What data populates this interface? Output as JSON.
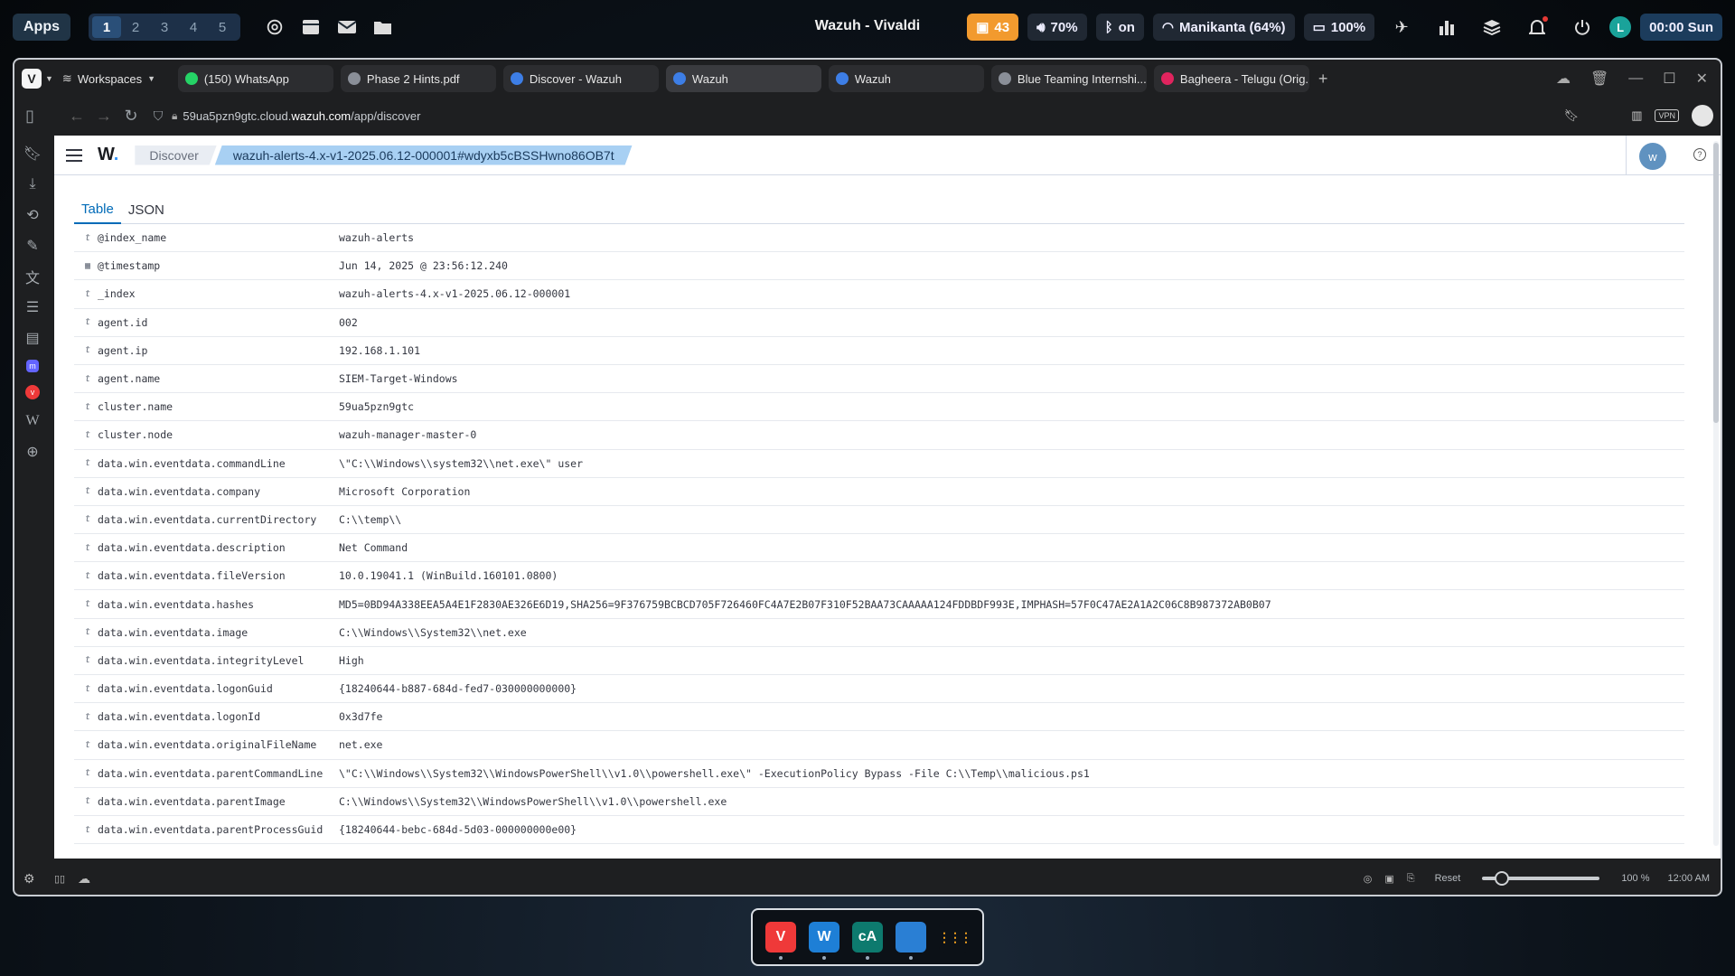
{
  "desktop": {
    "apps_label": "Apps",
    "workspaces": [
      "1",
      "2",
      "3",
      "4",
      "5"
    ],
    "active_workspace": "1",
    "window_title": "Wazuh - Vivaldi",
    "tray": {
      "updates": "43",
      "volume": "70%",
      "bluetooth": "on",
      "wifi": "Manikanta (64%)",
      "battery": "100%",
      "user_initial": "L",
      "clock": "00:00 Sun"
    }
  },
  "browser": {
    "workspaces_label": "Workspaces",
    "tabs": [
      {
        "label": "(150) WhatsApp",
        "icon": "whatsapp-icon",
        "color": "#25d366"
      },
      {
        "label": "Phase 2 Hints.pdf",
        "icon": "pdf-icon",
        "color": "#8a8f98"
      },
      {
        "label": "Discover - Wazuh",
        "icon": "wazuh-icon",
        "color": "#3d7ee6"
      },
      {
        "label": "Wazuh",
        "icon": "wazuh-icon",
        "color": "#3d7ee6"
      },
      {
        "label": "Wazuh",
        "icon": "wazuh-icon",
        "color": "#3d7ee6"
      },
      {
        "label": "Blue Teaming Internshi...",
        "icon": "link-icon",
        "color": "#8a8f98"
      },
      {
        "label": "Bagheera - Telugu (Orig...",
        "icon": "music-icon",
        "color": "#e0245e"
      }
    ],
    "active_tab": 3,
    "url_prefix": "59ua5pzn9gtc.cloud.",
    "url_domain": "wazuh.com",
    "url_path": "/app/discover",
    "status": {
      "reset_label": "Reset",
      "zoom": "100 %",
      "time": "12:00 AM",
      "zoom_fraction": 0.17
    }
  },
  "wazuh": {
    "logo": "W",
    "crumb_discover": "Discover",
    "crumb_doc": "wazuh-alerts-4.x-v1-2025.06.12-000001#wdyxb5cBSSHwno86OB7t",
    "avatar": "w",
    "tabs": [
      "Table",
      "JSON"
    ],
    "active_tab": "Table",
    "fields": [
      {
        "type": "t",
        "name": "@index_name",
        "value": "wazuh-alerts"
      },
      {
        "type": "date",
        "name": "@timestamp",
        "value": "Jun 14, 2025 @ 23:56:12.240"
      },
      {
        "type": "t",
        "name": "_index",
        "value": "wazuh-alerts-4.x-v1-2025.06.12-000001"
      },
      {
        "type": "t",
        "name": "agent.id",
        "value": "002"
      },
      {
        "type": "t",
        "name": "agent.ip",
        "value": "192.168.1.101"
      },
      {
        "type": "t",
        "name": "agent.name",
        "value": "SIEM-Target-Windows"
      },
      {
        "type": "t",
        "name": "cluster.name",
        "value": "59ua5pzn9gtc"
      },
      {
        "type": "t",
        "name": "cluster.node",
        "value": "wazuh-manager-master-0"
      },
      {
        "type": "t",
        "name": "data.win.eventdata.commandLine",
        "value": "\\\"C:\\\\Windows\\\\system32\\\\net.exe\\\" user"
      },
      {
        "type": "t",
        "name": "data.win.eventdata.company",
        "value": "Microsoft Corporation"
      },
      {
        "type": "t",
        "name": "data.win.eventdata.currentDirectory",
        "value": "C:\\\\temp\\\\"
      },
      {
        "type": "t",
        "name": "data.win.eventdata.description",
        "value": "Net Command"
      },
      {
        "type": "t",
        "name": "data.win.eventdata.fileVersion",
        "value": "10.0.19041.1 (WinBuild.160101.0800)"
      },
      {
        "type": "t",
        "name": "data.win.eventdata.hashes",
        "value": "MD5=0BD94A338EEA5A4E1F2830AE326E6D19,SHA256=9F376759BCBCD705F726460FC4A7E2B07F310F52BAA73CAAAAA124FDDBDF993E,IMPHASH=57F0C47AE2A1A2C06C8B987372AB0B07"
      },
      {
        "type": "t",
        "name": "data.win.eventdata.image",
        "value": "C:\\\\Windows\\\\System32\\\\net.exe"
      },
      {
        "type": "t",
        "name": "data.win.eventdata.integrityLevel",
        "value": "High"
      },
      {
        "type": "t",
        "name": "data.win.eventdata.logonGuid",
        "value": "{18240644-b887-684d-fed7-030000000000}"
      },
      {
        "type": "t",
        "name": "data.win.eventdata.logonId",
        "value": "0x3d7fe"
      },
      {
        "type": "t",
        "name": "data.win.eventdata.originalFileName",
        "value": "net.exe"
      },
      {
        "type": "t",
        "name": "data.win.eventdata.parentCommandLine",
        "value": "\\\"C:\\\\Windows\\\\System32\\\\WindowsPowerShell\\\\v1.0\\\\powershell.exe\\\" -ExecutionPolicy Bypass -File C:\\\\Temp\\\\malicious.ps1"
      },
      {
        "type": "t",
        "name": "data.win.eventdata.parentImage",
        "value": "C:\\\\Windows\\\\System32\\\\WindowsPowerShell\\\\v1.0\\\\powershell.exe"
      },
      {
        "type": "t",
        "name": "data.win.eventdata.parentProcessGuid",
        "value": "{18240644-bebc-684d-5d03-000000000e00}"
      }
    ]
  },
  "dock": [
    {
      "name": "vivaldi-dock-icon",
      "color": "#ef3939",
      "glyph": "V"
    },
    {
      "name": "monitor-dock-icon",
      "color": "#1e7fd6",
      "glyph": "W"
    },
    {
      "name": "calc-dock-icon",
      "color": "#0d7a6e",
      "glyph": "cA"
    },
    {
      "name": "files-dock-icon",
      "color": "#2a7fd4",
      "glyph": ""
    },
    {
      "name": "apps-grid-dock-icon",
      "color": "#0c1117",
      "glyph": "⋮⋮⋮"
    }
  ]
}
